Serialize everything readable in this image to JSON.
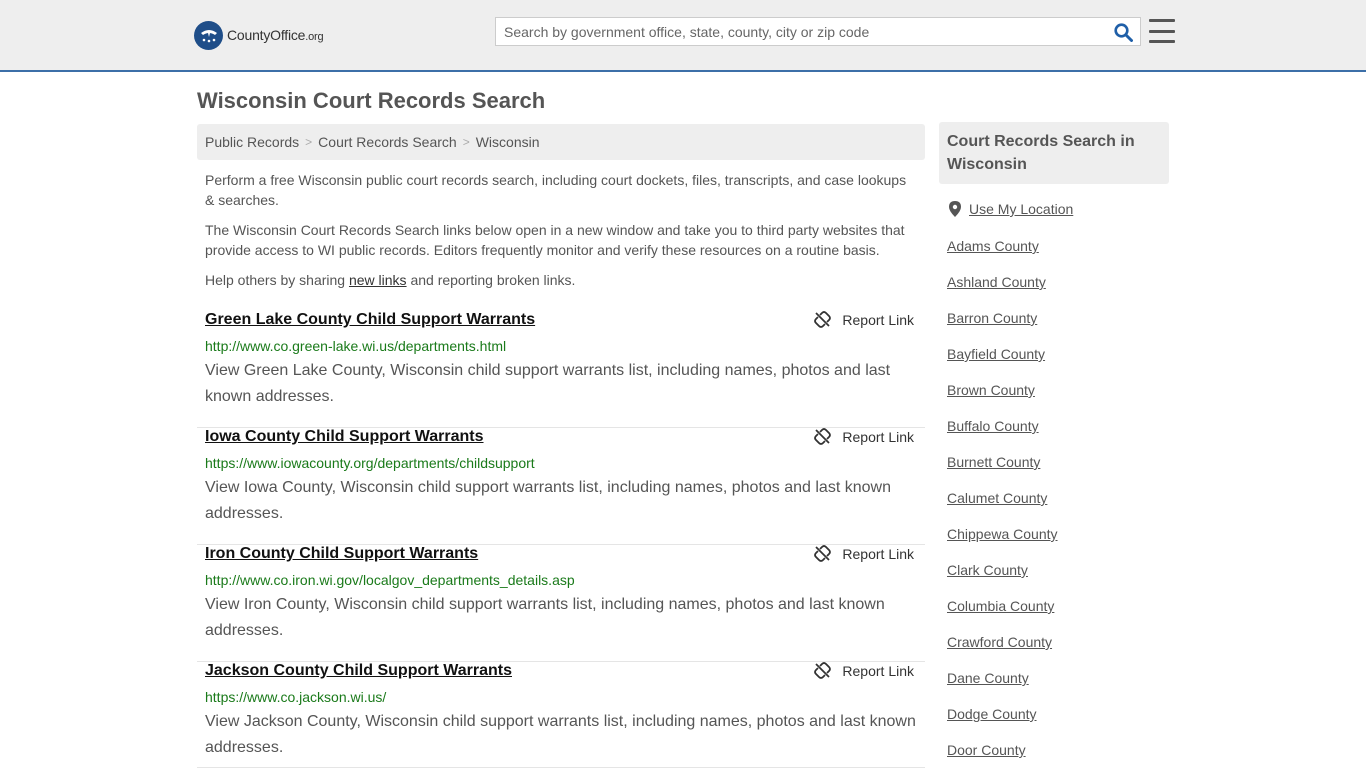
{
  "header": {
    "logo_text_main": "CountyOffice",
    "logo_text_org": ".org",
    "search_placeholder": "Search by government office, state, county, city or zip code"
  },
  "page_title": "Wisconsin Court Records Search",
  "breadcrumb": [
    "Public Records",
    "Court Records Search",
    "Wisconsin"
  ],
  "intro": {
    "p1": "Perform a free Wisconsin public court records search, including court dockets, files, transcripts, and case lookups & searches.",
    "p2": "The Wisconsin Court Records Search links below open in a new window and take you to third party websites that provide access to WI public records. Editors frequently monitor and verify these resources on a routine basis.",
    "p3_before": "Help others by sharing ",
    "p3_link": "new links",
    "p3_after": " and reporting broken links."
  },
  "report_label": "Report Link",
  "results": [
    {
      "title": "Green Lake County Child Support Warrants",
      "url": "http://www.co.green-lake.wi.us/departments.html",
      "desc": "View Green Lake County, Wisconsin child support warrants list, including names, photos and last known addresses."
    },
    {
      "title": "Iowa County Child Support Warrants",
      "url": "https://www.iowacounty.org/departments/childsupport",
      "desc": "View Iowa County, Wisconsin child support warrants list, including names, photos and last known addresses."
    },
    {
      "title": "Iron County Child Support Warrants",
      "url": "http://www.co.iron.wi.gov/localgov_departments_details.asp",
      "desc": "View Iron County, Wisconsin child support warrants list, including names, photos and last known addresses."
    },
    {
      "title": "Jackson County Child Support Warrants",
      "url": "https://www.co.jackson.wi.us/",
      "desc": "View Jackson County, Wisconsin child support warrants list, including names, photos and last known addresses."
    }
  ],
  "sidebar": {
    "heading": "Court Records Search in Wisconsin",
    "use_location": "Use My Location",
    "counties": [
      "Adams County",
      "Ashland County",
      "Barron County",
      "Bayfield County",
      "Brown County",
      "Buffalo County",
      "Burnett County",
      "Calumet County",
      "Chippewa County",
      "Clark County",
      "Columbia County",
      "Crawford County",
      "Dane County",
      "Dodge County",
      "Door County"
    ]
  },
  "colors": {
    "brand_blue": "#1f4e89",
    "url_green": "#1a7a1a",
    "header_border": "#3c6fa8"
  }
}
